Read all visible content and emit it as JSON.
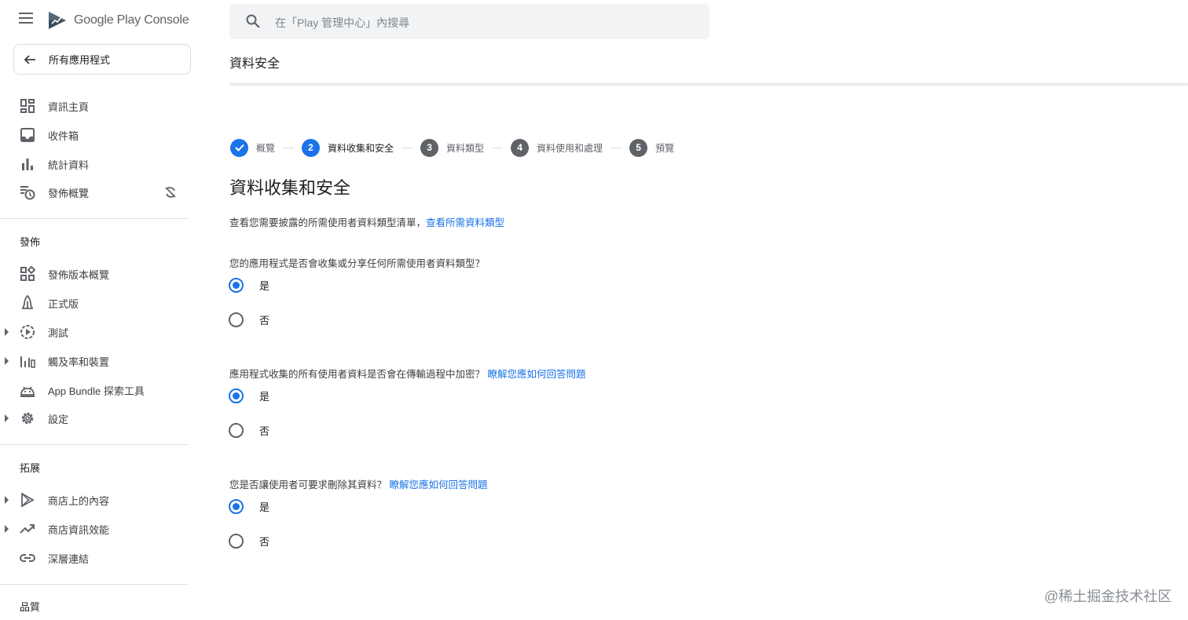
{
  "app": {
    "logo_text": "Google Play Console"
  },
  "sidebar": {
    "back_label": "所有應用程式",
    "items_top": [
      {
        "label": "資訊主頁",
        "icon": "dashboard-icon"
      },
      {
        "label": "收件箱",
        "icon": "inbox-icon"
      },
      {
        "label": "統計資料",
        "icon": "bar-chart-icon"
      },
      {
        "label": "發佈概覽",
        "icon": "publishing-overview-icon"
      }
    ],
    "section_release": "發佈",
    "items_release": [
      {
        "label": "發佈版本概覽",
        "icon": "releases-overview-icon"
      },
      {
        "label": "正式版",
        "icon": "production-icon"
      },
      {
        "label": "測試",
        "icon": "testing-icon"
      },
      {
        "label": "觸及率和裝置",
        "icon": "reach-devices-icon"
      },
      {
        "label": "App Bundle 探索工具",
        "icon": "android-icon"
      },
      {
        "label": "設定",
        "icon": "gear-icon"
      }
    ],
    "section_grow": "拓展",
    "items_grow": [
      {
        "label": "商店上的內容",
        "icon": "play-store-icon"
      },
      {
        "label": "商店資訊效能",
        "icon": "trending-up-icon"
      },
      {
        "label": "深層連結",
        "icon": "link-icon"
      }
    ],
    "section_quality": "品質"
  },
  "search": {
    "placeholder": "在「Play 管理中心」內搜尋"
  },
  "page": {
    "title": "資料安全",
    "stepper": [
      {
        "label": "概覽",
        "number": "",
        "state": "done"
      },
      {
        "label": "資料收集和安全",
        "number": "2",
        "state": "active"
      },
      {
        "label": "資料類型",
        "number": "3",
        "state": "todo"
      },
      {
        "label": "資料使用和處理",
        "number": "4",
        "state": "todo"
      },
      {
        "label": "預覽",
        "number": "5",
        "state": "todo"
      }
    ],
    "heading": "資料收集和安全",
    "intro_text": "查看您需要披露的所需使用者資料類型清單，",
    "intro_link": "查看所需資料類型",
    "questions": [
      {
        "text": "您的應用程式是否會收集或分享任何所需使用者資料類型？",
        "link": "",
        "yes": "是",
        "no": "否",
        "selected": "yes"
      },
      {
        "text": "應用程式收集的所有使用者資料是否會在傳輸過程中加密？",
        "link": "瞭解您應如何回答問題",
        "yes": "是",
        "no": "否",
        "selected": "yes"
      },
      {
        "text": "您是否讓使用者可要求刪除其資料？",
        "link": "瞭解您應如何回答問題",
        "yes": "是",
        "no": "否",
        "selected": "yes"
      }
    ]
  },
  "watermark": "@稀土掘金技术社区",
  "colors": {
    "accent": "#1a73e8",
    "icon_gray": "#5f6368",
    "search_bg": "#f1f3f4"
  }
}
